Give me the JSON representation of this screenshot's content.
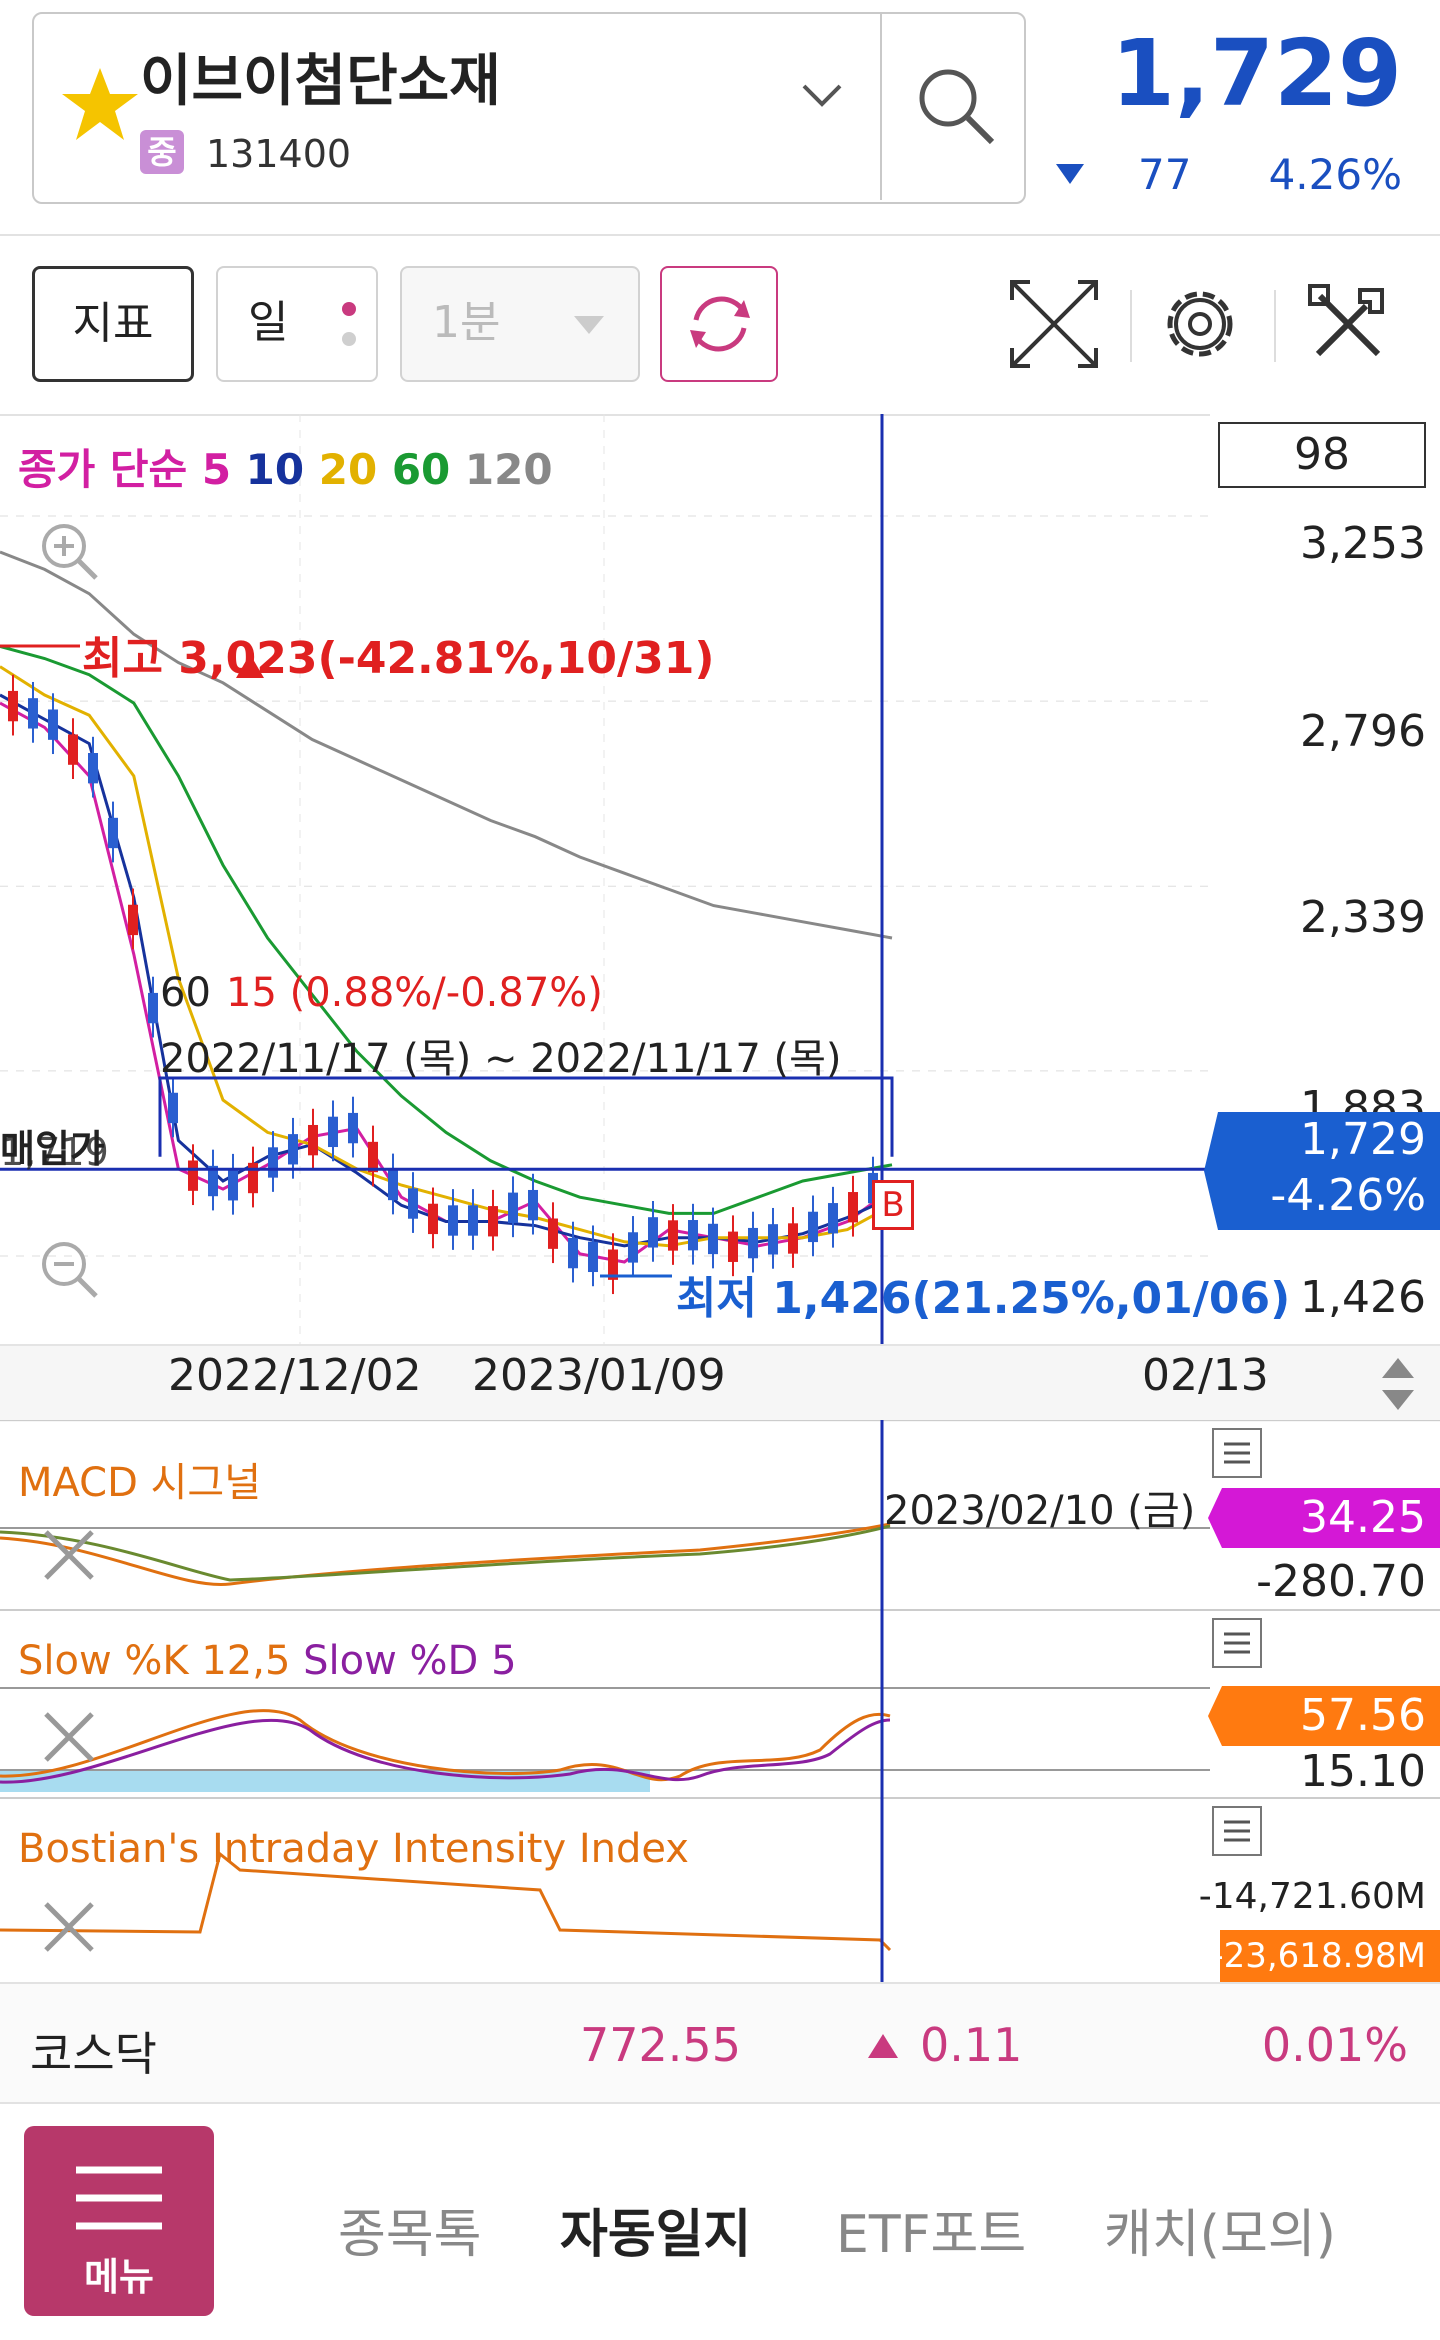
{
  "header": {
    "stock_name": "이브이첨단소재",
    "market_badge": "중",
    "stock_code": "131400",
    "price": "1,729",
    "change": "77",
    "change_pct": "4.26%",
    "star_icon": "star-icon",
    "dropdown_icon": "chevron-down-icon",
    "search_icon": "search-icon"
  },
  "toolbar": {
    "indicator_label": "지표",
    "period_label": "일",
    "minute_label": "1분",
    "icons": [
      "refresh-icon",
      "fullscreen-icon",
      "gear-icon",
      "tools-icon"
    ]
  },
  "chart": {
    "legend": {
      "prefix": "종가 단순",
      "ma5": "5",
      "ma10": "10",
      "ma20": "20",
      "ma60": "60",
      "ma120": "120"
    },
    "top_box": "98",
    "y_labels": [
      "3,253",
      "2,796",
      "2,339",
      "1,883",
      "1,426"
    ],
    "current_price": "1,729",
    "current_pct": "-4.26%",
    "high_annotation": "최고 3,023(-42.81%,10/31)",
    "low_annotation": "최저 1,426(21.25%,01/06)",
    "range_line1_prefix": "60",
    "range_line1_value": "15 (0.88%/-0.87%)",
    "range_line2": "2022/11/17 (목) ~ 2022/11/17 (목)",
    "left_label": "매입가",
    "left_value": "1,719",
    "buy_marker": "B",
    "x_dates": [
      "2022/12/02",
      "2023/01/09",
      "02/13"
    ],
    "colors": {
      "ma5": "#d21fa2",
      "ma10": "#16329c",
      "ma20": "#e2b100",
      "ma60": "#1a9a32",
      "ma120": "#888888",
      "up": "#e02020",
      "down": "#2a5fd0"
    }
  },
  "chart_data": {
    "type": "line",
    "title": "",
    "ylim": [
      1426,
      3253
    ],
    "y_ticks": [
      3253,
      2796,
      2339,
      1883,
      1426
    ],
    "x_tick_labels": [
      "2022/12/02",
      "2023/01/09",
      "02/13"
    ],
    "annotations": {
      "high": {
        "value": 3023,
        "pct": -42.81,
        "date": "10/31"
      },
      "low": {
        "value": 1426,
        "pct": 21.25,
        "date": "01/06"
      },
      "current": {
        "value": 1729,
        "pct": -4.26
      }
    },
    "series": [
      {
        "name": "5",
        "values": [
          2880,
          2820,
          2700,
          2260,
          1730,
          1680,
          1740,
          1810,
          1830,
          1660,
          1600,
          1600,
          1650,
          1520,
          1500,
          1580,
          1560,
          1540,
          1560,
          1600,
          1680
        ]
      },
      {
        "name": "10",
        "values": [
          2900,
          2840,
          2780,
          2400,
          1800,
          1700,
          1760,
          1790,
          1720,
          1640,
          1600,
          1600,
          1590,
          1560,
          1540,
          1560,
          1560,
          1550,
          1570,
          1610,
          1660
        ]
      },
      {
        "name": "20",
        "values": [
          2970,
          2900,
          2850,
          2700,
          2200,
          1900,
          1820,
          1790,
          1730,
          1690,
          1660,
          1630,
          1610,
          1580,
          1550,
          1540,
          1560,
          1560,
          1560,
          1580,
          1640
        ]
      },
      {
        "name": "60",
        "values": [
          3020,
          2990,
          2950,
          2880,
          2700,
          2480,
          2300,
          2160,
          2020,
          1910,
          1820,
          1750,
          1700,
          1660,
          1640,
          1620,
          1620,
          1660,
          1700,
          1720,
          1740
        ]
      },
      {
        "name": "120",
        "values": [
          3253,
          3210,
          3150,
          3050,
          2980,
          2930,
          2860,
          2790,
          2740,
          2690,
          2640,
          2590,
          2550,
          2500,
          2460,
          2420,
          2380,
          2360,
          2340,
          2320,
          2300
        ]
      }
    ]
  },
  "macd": {
    "title": "MACD 시그널",
    "date_label": "2023/02/10 (금)",
    "value1": "34.25",
    "value2": "-280.70",
    "menu_icon": "menu-icon"
  },
  "slow": {
    "title_k": "Slow %K 12,5",
    "title_d": "Slow %D 5",
    "value1": "57.56",
    "value2": "15.10"
  },
  "bostian": {
    "title": "Bostian's Intraday Intensity Index",
    "value1": "-14,721.60M",
    "value2": "-23,618.98M"
  },
  "index_bar": {
    "name": "코스닥",
    "value": "772.55",
    "change": "0.11",
    "pct": "0.01%"
  },
  "bottom_nav": {
    "menu_label": "메뉴",
    "items": [
      "종목톡",
      "자동일지",
      "ETF포트",
      "캐치(모의)"
    ]
  }
}
